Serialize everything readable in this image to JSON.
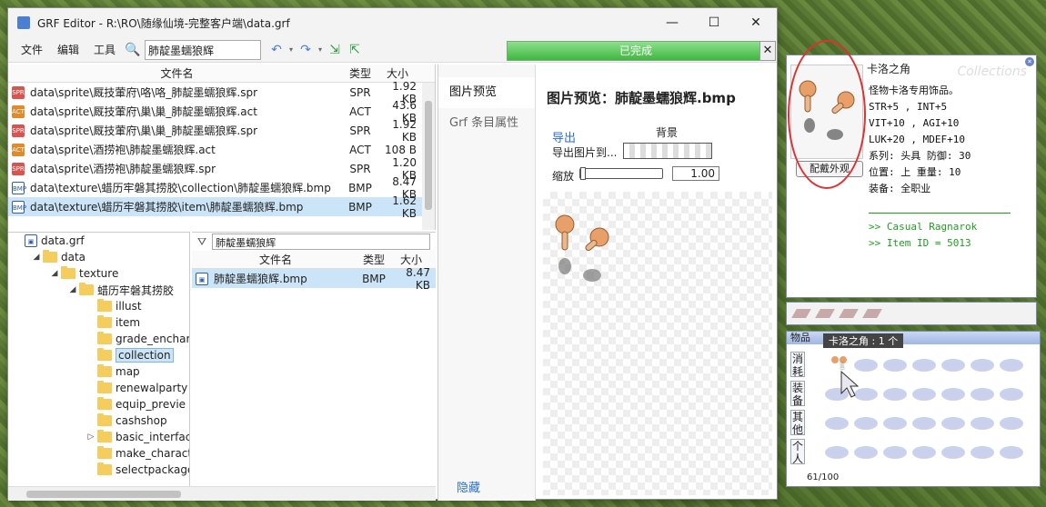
{
  "window": {
    "title": "GRF Editor - R:\\RO\\随缘仙境-完整客户端\\data.grf",
    "controls": {
      "minimize": "—",
      "maximize": "☐",
      "close": "✕"
    }
  },
  "menu": {
    "file": "文件",
    "edit": "编辑",
    "tools": "工具",
    "search_value": "肺靛墨蠕狼辉"
  },
  "status": {
    "progress_label": "已完成",
    "progress_fraction": 1.0,
    "close": "✕"
  },
  "filelist": {
    "headers": {
      "name": "文件名",
      "type": "类型",
      "size": "大小"
    },
    "rows": [
      {
        "icon": "SPR",
        "name": "data\\sprite\\厩技葷府\\咯\\咯_肺靛墨蠕狼辉.spr",
        "type": "SPR",
        "size": "1.92 KB"
      },
      {
        "icon": "ACT",
        "name": "data\\sprite\\厩技葷府\\巢\\巢_肺靛墨蠕狼辉.act",
        "type": "ACT",
        "size": "43.6 KB"
      },
      {
        "icon": "SPR",
        "name": "data\\sprite\\厩技葷府\\巢\\巢_肺靛墨蠕狼辉.spr",
        "type": "SPR",
        "size": "1.92 KB"
      },
      {
        "icon": "ACT",
        "name": "data\\sprite\\酒捞袍\\肺靛墨蠕狼辉.act",
        "type": "ACT",
        "size": "108 B"
      },
      {
        "icon": "SPR",
        "name": "data\\sprite\\酒捞袍\\肺靛墨蠕狼辉.spr",
        "type": "SPR",
        "size": "1.20 KB"
      },
      {
        "icon": "BMP",
        "name": "data\\texture\\蜡历牢磐其捞胶\\collection\\肺靛墨蠕狼辉.bmp",
        "type": "BMP",
        "size": "8.47 KB"
      },
      {
        "icon": "BMP",
        "name": "data\\texture\\蜡历牢磐其捞胶\\item\\肺靛墨蠕狼辉.bmp",
        "type": "BMP",
        "size": "1.62 KB"
      }
    ]
  },
  "tree": {
    "nodes": [
      {
        "label": "data.grf",
        "level": 0,
        "arrow": ""
      },
      {
        "label": "data",
        "level": 1,
        "arrow": "◢"
      },
      {
        "label": "texture",
        "level": 2,
        "arrow": "◢"
      },
      {
        "label": "蜡历牢磐其捞胶",
        "level": 3,
        "arrow": "◢"
      },
      {
        "label": "illust",
        "level": 4,
        "arrow": ""
      },
      {
        "label": "item",
        "level": 4,
        "arrow": ""
      },
      {
        "label": "grade_enchar",
        "level": 4,
        "arrow": ""
      },
      {
        "label": "collection",
        "level": 4,
        "arrow": "",
        "selected": true
      },
      {
        "label": "map",
        "level": 4,
        "arrow": ""
      },
      {
        "label": "renewalparty",
        "level": 4,
        "arrow": ""
      },
      {
        "label": "equip_previe",
        "level": 4,
        "arrow": ""
      },
      {
        "label": "cashshop",
        "level": 4,
        "arrow": ""
      },
      {
        "label": "basic_interfac",
        "level": 4,
        "arrow": "▷"
      },
      {
        "label": "make_charact",
        "level": 4,
        "arrow": ""
      },
      {
        "label": "selectpackage",
        "level": 4,
        "arrow": ""
      }
    ]
  },
  "minilist": {
    "filter_value": "肺靛墨蠕狼辉",
    "headers": {
      "name": "文件名",
      "type": "类型",
      "size": "大小"
    },
    "rows": [
      {
        "name": "肺靛墨蠕狼辉.bmp",
        "type": "BMP",
        "size": "8.47 KB"
      }
    ]
  },
  "tabs": [
    {
      "label": "图片预览"
    },
    {
      "label": "Grf 条目属性"
    }
  ],
  "hide_label": "隐藏",
  "preview": {
    "title": "图片预览：肺靛墨蠕狼辉.bmp",
    "export_link": "导出",
    "background_label": "背景",
    "export_to_label": "导出图片到...",
    "zoom_label": "缩放",
    "zoom_value": "1.00"
  },
  "item_window": {
    "title": "卡洛之角",
    "watermark": "Collections",
    "button": "配戴外观",
    "lines": [
      "怪物卡洛专用饰品。",
      "STR+5 , INT+5",
      "VIT+10 , AGI+10",
      "LUK+20 , MDEF+10",
      "系列: 头具  防御: 30",
      "位置: 上  重量: 10",
      "装备: 全职业"
    ],
    "footer": [
      ">> Casual Ragnarok",
      ">> Item ID = 5013"
    ]
  },
  "inventory": {
    "title": "物品",
    "tooltip": "卡洛之角 : 1 个",
    "tabs": [
      "消耗",
      "装备",
      "其他",
      "个人"
    ],
    "count": "61/100",
    "item_qty": "1"
  }
}
